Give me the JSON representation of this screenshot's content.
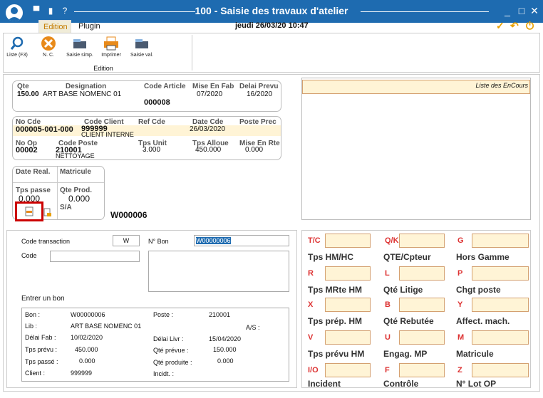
{
  "window": {
    "title": "100 - Saisie des travaux d'atelier",
    "datetime": "jeudi 26/03/20  10:47"
  },
  "tabs": {
    "edition": "Edition",
    "plugin": "Plugin"
  },
  "ribbon": {
    "liste": "Liste (F3)",
    "nc": "N. C.",
    "saisie_simp": "Saisie simp.",
    "imprimer": "Imprimer",
    "saisie_val": "Saisie val.",
    "group": "Edition"
  },
  "header": {
    "qte_lbl": "Qte",
    "qte": "150.00",
    "desig_lbl": "Designation",
    "desig": "ART BASE NOMENC 01",
    "codeart_lbl": "Code Article",
    "codeart": "000008",
    "mef_lbl": "Mise En Fab",
    "mef": "07/2020",
    "delai_lbl": "Delai Prevu",
    "delai": "16/2020"
  },
  "commande": {
    "nocde_lbl": "No Cde",
    "nocde": "000005-001-000",
    "codecli_lbl": "Code Client",
    "codecli": "999999",
    "client": "CLIENT INTERNE",
    "refcde_lbl": "Ref Cde",
    "datecde_lbl": "Date Cde",
    "datecde": "26/03/2020",
    "posteprec_lbl": "Poste Prec",
    "noop_lbl": "No Op",
    "noop": "00002",
    "codeposte_lbl": "Code Poste",
    "codeposte": "210001",
    "poste": "NETTOYAGE",
    "tpsunit_lbl": "Tps Unit",
    "tpsunit": "3.000",
    "tpsalloue_lbl": "Tps Alloue",
    "tpsalloue": "450.000",
    "mer_lbl": "Mise En Rte",
    "mer": "0.000"
  },
  "real": {
    "datereal_lbl": "Date Real.",
    "matricule_lbl": "Matricule",
    "tpspasse_lbl": "Tps passe",
    "tpspasse": "0.000",
    "qteprod_lbl": "Qte Prod.",
    "qteprod": "0.000",
    "sa_lbl": "S/A",
    "bon": "W000006"
  },
  "encours": {
    "title": "Liste des EnCours"
  },
  "trans": {
    "codetrans_lbl": "Code transaction",
    "codetrans": "W",
    "nbon_lbl": "N° Bon",
    "nbon": "W00000006",
    "code_lbl": "Code",
    "entrer": "Entrer un bon"
  },
  "bon": {
    "bon_lbl": "Bon :",
    "bon": "W00000006",
    "poste_lbl": "Poste :",
    "poste": "210001",
    "lib_lbl": "Lib :",
    "lib": "ART BASE NOMENC 01",
    "as_lbl": "A/S :",
    "delaifab_lbl": "Délai Fab :",
    "delaifab": "10/02/2020",
    "delailivr_lbl": "Délai Livr :",
    "delailivr": "15/04/2020",
    "tpsprevu_lbl": "Tps prévu :",
    "tpsprevu": "450.000",
    "qteprevue_lbl": "Qté prévue :",
    "qteprevue": "150.000",
    "tpspasse_lbl": "Tps passé :",
    "tpspasse": "0.000",
    "qteproduite_lbl": "Qté produite :",
    "qteproduite": "0.000",
    "client_lbl": "Client :",
    "client": "999999",
    "incidt_lbl": "Incidt. :"
  },
  "keys": {
    "r1": [
      "T/C",
      "Q/K",
      "G"
    ],
    "g1": [
      "Tps HM/HC",
      "QTE/Cpteur",
      "Hors Gamme"
    ],
    "r2": [
      "R",
      "L",
      "P"
    ],
    "g2": [
      "Tps MRte HM",
      "Qté Litige",
      "Chgt poste"
    ],
    "r3": [
      "X",
      "B",
      "Y"
    ],
    "g3": [
      "Tps prép. HM",
      "Qté Rebutée",
      "Affect. mach."
    ],
    "r4": [
      "V",
      "U",
      "M"
    ],
    "g4": [
      "Tps prévu HM",
      "Engag. MP",
      "Matricule"
    ],
    "r5": [
      "I/O",
      "F",
      "Z"
    ],
    "g5": [
      "Incident",
      "Contrôle",
      "N° Lot OP"
    ]
  },
  "colors": {
    "titlebar": "#1e6bb0",
    "accent": "#e8a000",
    "field": "#fff4d6",
    "red_label": "#dd3333"
  }
}
